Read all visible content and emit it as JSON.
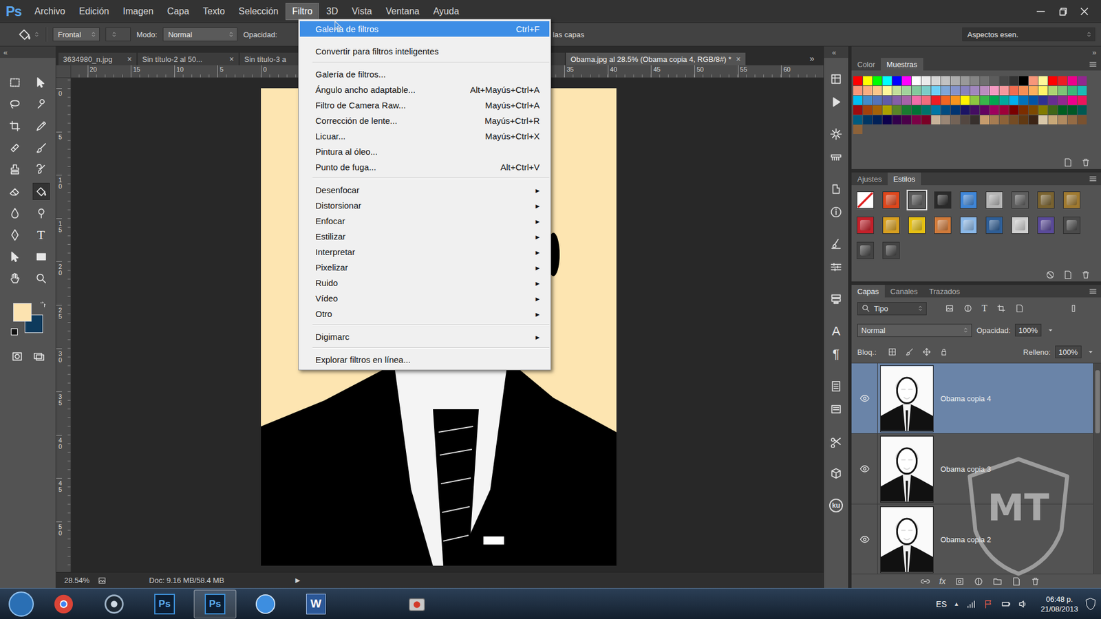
{
  "app_logo": "Ps",
  "menubar": [
    {
      "label": "Archivo",
      "selected": false
    },
    {
      "label": "Edición",
      "selected": false
    },
    {
      "label": "Imagen",
      "selected": false
    },
    {
      "label": "Capa",
      "selected": false
    },
    {
      "label": "Texto",
      "selected": false
    },
    {
      "label": "Selección",
      "selected": false
    },
    {
      "label": "Filtro",
      "selected": true
    },
    {
      "label": "3D",
      "selected": false
    },
    {
      "label": "Vista",
      "selected": false
    },
    {
      "label": "Ventana",
      "selected": false
    },
    {
      "label": "Ayuda",
      "selected": false
    }
  ],
  "options_bar": {
    "preset": "Frontal",
    "mode_label": "Modo:",
    "mode": "Normal",
    "opacity_label": "Opacidad:",
    "all_layers": "das las capas",
    "workspace": "Aspectos esen."
  },
  "collapse_glyphs": {
    "toolbar": "«",
    "dock": "«",
    "panels": "»"
  },
  "document_tabs": [
    {
      "label": "3634980_n.jpg",
      "selected": false,
      "closable": true
    },
    {
      "label": "Sin título-2 al 50...",
      "selected": false,
      "closable": true
    },
    {
      "label": "Sin título-3 a",
      "selected": false,
      "closable": false
    },
    {
      "label": "Obama.jpg al 28.5% (Obama copia 4, RGB/8#) *",
      "selected": true,
      "closable": true
    }
  ],
  "tab_close": "×",
  "tabs_overflow": "»",
  "toolbar": {
    "tools": [
      {
        "kind": "marquee",
        "selected": false
      },
      {
        "kind": "move",
        "selected": false
      },
      {
        "kind": "lasso",
        "selected": false
      },
      {
        "kind": "quickselect",
        "selected": false
      },
      {
        "kind": "crop",
        "selected": false
      },
      {
        "kind": "eyedropper",
        "selected": false
      },
      {
        "kind": "healing",
        "selected": false
      },
      {
        "kind": "brush",
        "selected": false
      },
      {
        "kind": "stamp",
        "selected": false
      },
      {
        "kind": "historybrush",
        "selected": false
      },
      {
        "kind": "eraser",
        "selected": false
      },
      {
        "kind": "bucket",
        "selected": true
      },
      {
        "kind": "blur",
        "selected": false
      },
      {
        "kind": "dodge",
        "selected": false
      },
      {
        "kind": "pen",
        "selected": false
      },
      {
        "kind": "type",
        "selected": false,
        "glyph": "T"
      },
      {
        "kind": "pathselect",
        "selected": false
      },
      {
        "kind": "shape",
        "selected": false
      },
      {
        "kind": "hand",
        "selected": false
      },
      {
        "kind": "zoom",
        "selected": false
      }
    ],
    "foreground": "#fce3b0",
    "background": "#0e3a5c"
  },
  "rulers": {
    "top": [
      {
        "label": "20",
        "value": -20
      },
      {
        "label": "15",
        "value": -15
      },
      {
        "label": "10",
        "value": -10
      },
      {
        "label": "5",
        "value": -5
      },
      {
        "label": "0",
        "value": 0
      },
      {
        "label": "35",
        "value": 35
      },
      {
        "label": "40",
        "value": 40
      },
      {
        "label": "45",
        "value": 45
      },
      {
        "label": "50",
        "value": 50
      },
      {
        "label": "55",
        "value": 55
      },
      {
        "label": "60",
        "value": 60
      }
    ],
    "left": [
      {
        "label": "0",
        "value": 0
      },
      {
        "label": "5",
        "value": 5
      },
      {
        "label": "10",
        "value": 10
      },
      {
        "label": "15",
        "value": 15
      },
      {
        "label": "20",
        "value": 20
      },
      {
        "label": "25",
        "value": 25
      },
      {
        "label": "30",
        "value": 30
      },
      {
        "label": "35",
        "value": 35
      },
      {
        "label": "40",
        "value": 40
      },
      {
        "label": "45",
        "value": 45
      },
      {
        "label": "50",
        "value": 50
      }
    ]
  },
  "status_bar": {
    "zoom": "28.54%",
    "doc": "Doc: 9.16 MB/58.4 MB",
    "arrow": "▶"
  },
  "dock_glyphs": {
    "character": "A",
    "paragraph": "¶",
    "plugin": "ku"
  },
  "color_panel": {
    "tabs": [
      {
        "label": "Color",
        "selected": false
      },
      {
        "label": "Muestras",
        "selected": true
      }
    ],
    "swatches": [
      {
        "color": "#ff0000"
      },
      {
        "color": "#ffff00"
      },
      {
        "color": "#00ff00"
      },
      {
        "color": "#00ffff"
      },
      {
        "color": "#0000ff"
      },
      {
        "color": "#ff00ff"
      },
      {
        "color": "#ffffff"
      },
      {
        "color": "#ebebeb"
      },
      {
        "color": "#d6d6d6"
      },
      {
        "color": "#c2c2c2"
      },
      {
        "color": "#adadad"
      },
      {
        "color": "#999999"
      },
      {
        "color": "#858585"
      },
      {
        "color": "#707070"
      },
      {
        "color": "#5c5c5c"
      },
      {
        "color": "#474747"
      },
      {
        "color": "#333333"
      },
      {
        "color": "#000000"
      },
      {
        "color": "#f7977a"
      },
      {
        "color": "#fff79a"
      },
      {
        "color": "#ff0000"
      },
      {
        "color": "#ed1c24"
      },
      {
        "color": "#ec008c"
      },
      {
        "color": "#92278f"
      },
      {
        "color": "#f7977a"
      },
      {
        "color": "#f9ad81"
      },
      {
        "color": "#fdc68a"
      },
      {
        "color": "#fff79a"
      },
      {
        "color": "#c4df9b"
      },
      {
        "color": "#a2d39c"
      },
      {
        "color": "#82ca9d"
      },
      {
        "color": "#7bcdc8"
      },
      {
        "color": "#6ecff6"
      },
      {
        "color": "#7ea7d8"
      },
      {
        "color": "#8493ca"
      },
      {
        "color": "#8882be"
      },
      {
        "color": "#a187be"
      },
      {
        "color": "#bc8dbf"
      },
      {
        "color": "#f49ac2"
      },
      {
        "color": "#f6989d"
      },
      {
        "color": "#f26c4f"
      },
      {
        "color": "#f68e55"
      },
      {
        "color": "#fbaf5c"
      },
      {
        "color": "#fff467"
      },
      {
        "color": "#acd372"
      },
      {
        "color": "#7cc576"
      },
      {
        "color": "#3bb878"
      },
      {
        "color": "#1abbb4"
      },
      {
        "color": "#00bff3"
      },
      {
        "color": "#438cca"
      },
      {
        "color": "#5574b9"
      },
      {
        "color": "#605ca8"
      },
      {
        "color": "#855fa8"
      },
      {
        "color": "#a763a8"
      },
      {
        "color": "#f06ea9"
      },
      {
        "color": "#f26d7d"
      },
      {
        "color": "#ed1c24"
      },
      {
        "color": "#f26522"
      },
      {
        "color": "#f7941d"
      },
      {
        "color": "#fff200"
      },
      {
        "color": "#8dc73f"
      },
      {
        "color": "#39b54a"
      },
      {
        "color": "#00a651"
      },
      {
        "color": "#00a99d"
      },
      {
        "color": "#00aeef"
      },
      {
        "color": "#0072bc"
      },
      {
        "color": "#0054a6"
      },
      {
        "color": "#2e3192"
      },
      {
        "color": "#662d91"
      },
      {
        "color": "#92278f"
      },
      {
        "color": "#ec008c"
      },
      {
        "color": "#ed145b"
      },
      {
        "color": "#9e0b0f"
      },
      {
        "color": "#a0410d"
      },
      {
        "color": "#a36209"
      },
      {
        "color": "#aba000"
      },
      {
        "color": "#598527"
      },
      {
        "color": "#1a7b30"
      },
      {
        "color": "#007236"
      },
      {
        "color": "#00746b"
      },
      {
        "color": "#0076a3"
      },
      {
        "color": "#004b80"
      },
      {
        "color": "#003471"
      },
      {
        "color": "#1b1464"
      },
      {
        "color": "#440e62"
      },
      {
        "color": "#630460"
      },
      {
        "color": "#9e005d"
      },
      {
        "color": "#9e0039"
      },
      {
        "color": "#790000"
      },
      {
        "color": "#7b2e00"
      },
      {
        "color": "#7d4900"
      },
      {
        "color": "#827b00"
      },
      {
        "color": "#406618"
      },
      {
        "color": "#005e20"
      },
      {
        "color": "#005826"
      },
      {
        "color": "#005952"
      },
      {
        "color": "#005b7f"
      },
      {
        "color": "#003663"
      },
      {
        "color": "#002157"
      },
      {
        "color": "#0d004c"
      },
      {
        "color": "#32004b"
      },
      {
        "color": "#4b0049"
      },
      {
        "color": "#7b0046"
      },
      {
        "color": "#7a0026"
      },
      {
        "color": "#c7b299"
      },
      {
        "color": "#998675"
      },
      {
        "color": "#736357"
      },
      {
        "color": "#534741"
      },
      {
        "color": "#37302d"
      },
      {
        "color": "#c69c6d"
      },
      {
        "color": "#a67c52"
      },
      {
        "color": "#8c6239"
      },
      {
        "color": "#754c24"
      },
      {
        "color": "#603913"
      },
      {
        "color": "#3c2415"
      },
      {
        "color": "#d9c8a9"
      },
      {
        "color": "#c8a878"
      },
      {
        "color": "#b08a60"
      },
      {
        "color": "#946b45"
      },
      {
        "color": "#7a5230"
      },
      {
        "color": "#8c6239"
      }
    ]
  },
  "styles_panel": {
    "tabs": [
      {
        "label": "Ajustes",
        "selected": false
      },
      {
        "label": "Estilos",
        "selected": true
      }
    ],
    "styles": [
      {
        "kind": "none",
        "color": "#ffffff",
        "selected": false
      },
      {
        "kind": "style",
        "color": "#e0471c",
        "selected": false
      },
      {
        "kind": "style",
        "color": "#5a5a5a",
        "selected": true
      },
      {
        "kind": "style",
        "color": "#2a2a2a",
        "selected": false
      },
      {
        "kind": "style",
        "color": "#3f86d8",
        "selected": false
      },
      {
        "kind": "style",
        "color": "#b4b4b4",
        "selected": false
      },
      {
        "kind": "style",
        "color": "#5e5e5e",
        "selected": false
      },
      {
        "kind": "style",
        "color": "#7a6330",
        "selected": false
      },
      {
        "kind": "style",
        "color": "#a07a30",
        "selected": false
      },
      {
        "kind": "style",
        "color": "#c4202a",
        "selected": false
      },
      {
        "kind": "style",
        "color": "#d8a020",
        "selected": false
      },
      {
        "kind": "style",
        "color": "#e6c012",
        "selected": false
      },
      {
        "kind": "style",
        "color": "#d07a3a",
        "selected": false
      },
      {
        "kind": "style",
        "color": "#8ab8e8",
        "selected": false
      },
      {
        "kind": "style",
        "color": "#2e5e96",
        "selected": false
      },
      {
        "kind": "style",
        "color": "#cfcfcf",
        "selected": false
      },
      {
        "kind": "style",
        "color": "#5a4a9a",
        "selected": false
      },
      {
        "kind": "style",
        "color": "#4a4a4a",
        "selected": false
      },
      {
        "kind": "style",
        "color": "#444444",
        "selected": false
      },
      {
        "kind": "style",
        "color": "#444444",
        "selected": false
      }
    ]
  },
  "layers_panel": {
    "tabs": [
      {
        "label": "Capas",
        "selected": true
      },
      {
        "label": "Canales",
        "selected": false
      },
      {
        "label": "Trazados",
        "selected": false
      }
    ],
    "filter": "Tipo",
    "filter_glyph": "T",
    "blend_mode": "Normal",
    "opacity_label": "Opacidad:",
    "opacity": "100%",
    "lock_label": "Bloq.:",
    "fill_label": "Relleno:",
    "fill": "100%",
    "fx": "fx",
    "layers": [
      {
        "name": "Obama copia 4",
        "visible": true,
        "selected": true
      },
      {
        "name": "Obama copia 3",
        "visible": true,
        "selected": false
      },
      {
        "name": "Obama copia 2",
        "visible": true,
        "selected": false
      }
    ]
  },
  "filter_menu": {
    "submenu_arrow": "▸",
    "items": [
      {
        "kind": "command",
        "label": "Galería de filtros",
        "shortcut": "Ctrl+F",
        "selected": true
      },
      {
        "kind": "gap"
      },
      {
        "kind": "command",
        "label": "Convertir para filtros inteligentes",
        "selected": false
      },
      {
        "kind": "separator"
      },
      {
        "kind": "command",
        "label": "Galería de filtros...",
        "selected": false
      },
      {
        "kind": "command",
        "label": "Ángulo ancho adaptable...",
        "shortcut": "Alt+Mayús+Ctrl+A",
        "selected": false
      },
      {
        "kind": "command",
        "label": "Filtro de Camera Raw...",
        "shortcut": "Mayús+Ctrl+A",
        "selected": false
      },
      {
        "kind": "command",
        "label": "Corrección de lente...",
        "shortcut": "Mayús+Ctrl+R",
        "selected": false
      },
      {
        "kind": "command",
        "label": "Licuar...",
        "shortcut": "Mayús+Ctrl+X",
        "selected": false
      },
      {
        "kind": "command",
        "label": "Pintura al óleo...",
        "selected": false
      },
      {
        "kind": "command",
        "label": "Punto de fuga...",
        "shortcut": "Alt+Ctrl+V",
        "selected": false
      },
      {
        "kind": "separator"
      },
      {
        "kind": "submenu",
        "label": "Desenfocar",
        "selected": false
      },
      {
        "kind": "submenu",
        "label": "Distorsionar",
        "selected": false
      },
      {
        "kind": "submenu",
        "label": "Enfocar",
        "selected": false
      },
      {
        "kind": "submenu",
        "label": "Estilizar",
        "selected": false
      },
      {
        "kind": "submenu",
        "label": "Interpretar",
        "selected": false
      },
      {
        "kind": "submenu",
        "label": "Pixelizar",
        "selected": false
      },
      {
        "kind": "submenu",
        "label": "Ruido",
        "selected": false
      },
      {
        "kind": "submenu",
        "label": "Vídeo",
        "selected": false
      },
      {
        "kind": "submenu",
        "label": "Otro",
        "selected": false
      },
      {
        "kind": "separator"
      },
      {
        "kind": "submenu",
        "label": "Digimarc",
        "selected": false
      },
      {
        "kind": "separator"
      },
      {
        "kind": "command",
        "label": "Explorar filtros en línea...",
        "selected": false
      }
    ]
  },
  "watermark": {
    "text": "MT"
  },
  "taskbar": {
    "apps": [
      {
        "kind": "chrome",
        "glyph": "",
        "selected": false
      },
      {
        "kind": "media",
        "glyph": "",
        "selected": false
      },
      {
        "kind": "ps",
        "glyph": "Ps",
        "selected": false
      },
      {
        "kind": "ps",
        "glyph": "Ps",
        "selected": true
      },
      {
        "kind": "itunes",
        "glyph": "",
        "selected": false
      },
      {
        "kind": "word",
        "glyph": "W",
        "selected": false
      },
      {
        "kind": "folder",
        "glyph": "",
        "selected": false
      },
      {
        "kind": "recorder",
        "glyph": "",
        "selected": false
      }
    ],
    "language": "ES",
    "tray_arrow": "▲",
    "time": "06:48 p.",
    "date": "21/08/2013"
  }
}
